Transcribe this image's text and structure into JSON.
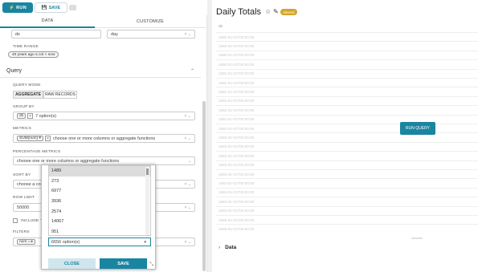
{
  "toolbar": {
    "run_label": "RUN",
    "save_label": "SAVE",
    "run_icon": "lightning-icon",
    "save_icon": "floppy-disk-icon"
  },
  "tabs": [
    {
      "label": "DATA"
    },
    {
      "label": "CUSTOMIZE"
    }
  ],
  "time": {
    "column_value": "ds",
    "grain_value": "day",
    "range_label": "TIME RANGE",
    "range_value": "40 years ago ≤ col < now"
  },
  "query": {
    "section_title": "Query",
    "mode_label": "QUERY MODE",
    "mode_options": [
      "AGGREGATE",
      "RAW RECORDS"
    ],
    "group_by_label": "GROUP BY",
    "group_by_tag": "ds",
    "group_by_more": "7 option(s)",
    "metrics_label": "METRICS",
    "metrics_tag": "SUM(num) ▾",
    "metrics_placeholder": "choose one or more columns or aggregate functions",
    "percentage_label": "PERCENTAGE METRICS",
    "percentage_placeholder": "choose one or more columns or aggregate functions",
    "sort_label": "SORT BY",
    "sort_placeholder": "choose a co",
    "row_limit_label": "ROW LIMIT",
    "row_limit_value": "50000",
    "include_label": "INCLUDE TI",
    "filters_label": "FILTERS",
    "filter_tag": "num = ▸"
  },
  "popover": {
    "options": [
      "1489",
      "273",
      "6977",
      "3936",
      "2574",
      "14067",
      "951"
    ],
    "input_placeholder": "6656 option(s)",
    "close_label": "CLOSE",
    "save_label": "SAVE"
  },
  "chart": {
    "title": "Daily Totals",
    "badge": "Altered",
    "column_header": "ds",
    "rows": [
      "1880-01-01T00:00:00",
      "1880-01-01T00:00:00",
      "1880-01-01T00:00:00",
      "1880-01-01T00:00:00",
      "1881-01-01T00:00:00",
      "1881-01-01T00:00:00",
      "1881-01-01T00:00:00",
      "1881-01-01T00:00:00",
      "1882-01-01T00:00:00",
      "1882-01-01T00:00:00",
      "1882-01-01T00:00:00",
      "1882-01-01T00:00:00",
      "1883-01-01T00:00:00",
      "1883-01-01T00:00:00",
      "1883-01-01T00:00:00",
      "1883-01-01T00:00:00",
      "1884-01-01T00:00:00",
      "1884-01-01T00:00:00",
      "1884-01-01T00:00:00",
      "1884-01-01T00:00:00",
      "1885-01-01T00:00:00",
      "1885-01-01T00:00:00"
    ],
    "run_query_label": "RUN QUERY",
    "data_section": "Data"
  },
  "colors": {
    "accent": "#1a85a0",
    "badge": "#d4a42b"
  }
}
